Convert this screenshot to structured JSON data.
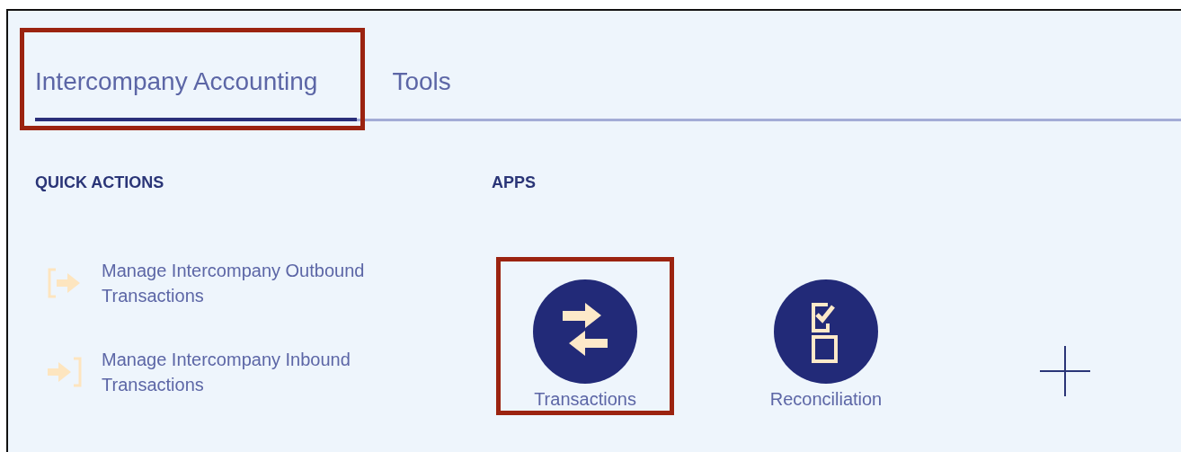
{
  "tabs": [
    {
      "label": "Intercompany Accounting",
      "selected": true,
      "highlighted": true
    },
    {
      "label": "Tools",
      "selected": false,
      "highlighted": false
    }
  ],
  "quick_actions": {
    "heading": "QUICK ACTIONS",
    "items": [
      {
        "label": "Manage Intercompany Outbound Transactions",
        "kind": "outbound"
      },
      {
        "label": "Manage Intercompany Inbound Transactions",
        "kind": "inbound"
      }
    ]
  },
  "apps": {
    "heading": "APPS",
    "items": [
      {
        "label": "Transactions",
        "kind": "transfer",
        "highlighted": true
      },
      {
        "label": "Reconciliation",
        "kind": "checklist",
        "highlighted": false
      }
    ]
  }
}
